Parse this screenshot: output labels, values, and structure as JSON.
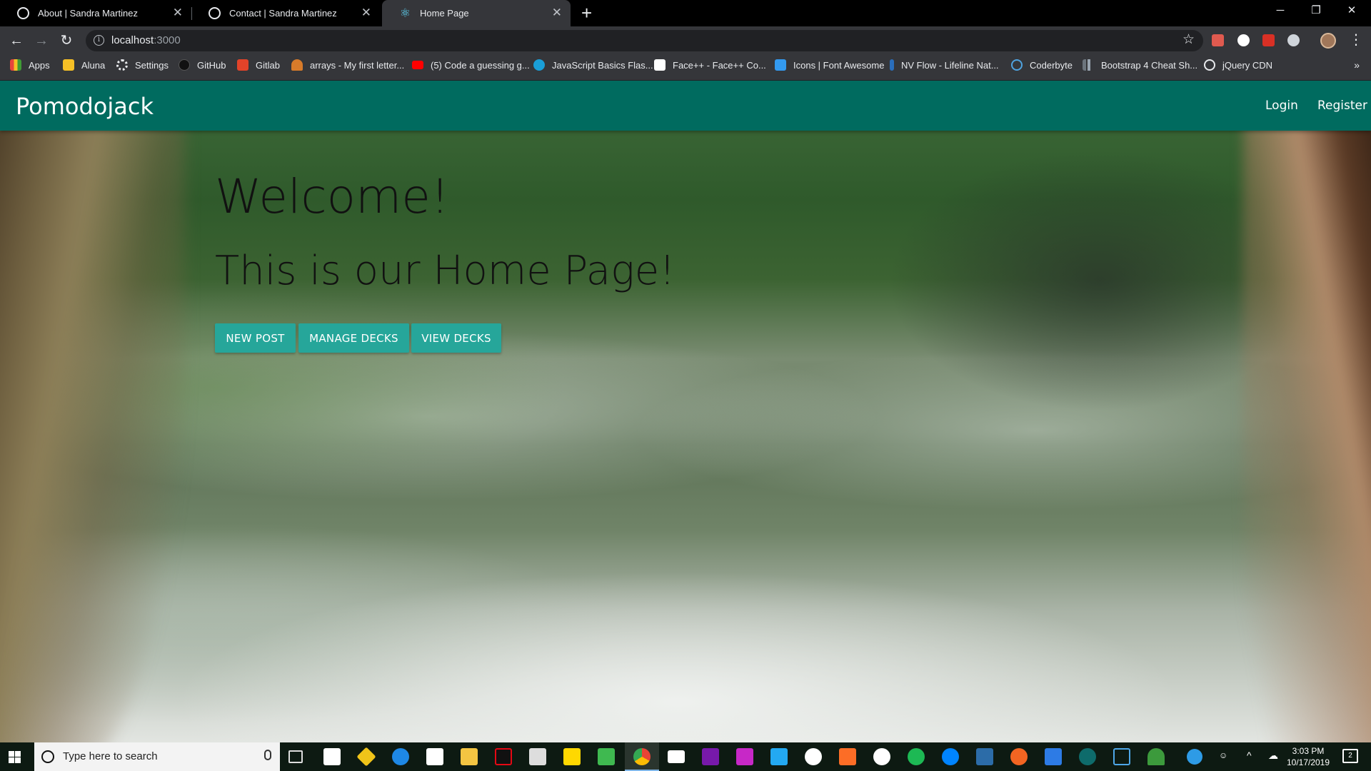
{
  "browser": {
    "tabs": [
      {
        "title": "About | Sandra Martinez",
        "active": false,
        "icon": "github-icon"
      },
      {
        "title": "Contact | Sandra Martinez",
        "active": false,
        "icon": "github-icon"
      },
      {
        "title": "Home Page",
        "active": true,
        "icon": "react-icon"
      }
    ],
    "url_host": "localhost",
    "url_port": ":3000",
    "bookmarks": [
      {
        "label": "Apps",
        "icon": "apps-grid-icon",
        "color": "#e8453c"
      },
      {
        "label": "Aluna",
        "icon": "folder-icon",
        "color": "#f6c026"
      },
      {
        "label": "Settings",
        "icon": "gear-icon",
        "color": "#e8eaed"
      },
      {
        "label": "GitHub",
        "icon": "github-icon",
        "color": "#202124"
      },
      {
        "label": "Gitlab",
        "icon": "gitlab-icon",
        "color": "#e24329"
      },
      {
        "label": "arrays - My first letter...",
        "icon": "person-icon",
        "color": "#d77b2a"
      },
      {
        "label": "(5) Code a guessing g...",
        "icon": "youtube-icon",
        "color": "#ff0000"
      },
      {
        "label": "JavaScript Basics Flas...",
        "icon": "c-icon",
        "color": "#1a9fd8"
      },
      {
        "label": "Face++ - Face++ Co...",
        "icon": "m-icon",
        "color": "#ffffff"
      },
      {
        "label": "Icons | Font Awesome",
        "icon": "flag-icon",
        "color": "#339af0"
      },
      {
        "label": "NV Flow - Lifeline Nat...",
        "icon": "nv-icon",
        "color": "#2a6ebb"
      },
      {
        "label": "Coderbyte",
        "icon": "hexagon-icon",
        "color": "#4fa3e0"
      },
      {
        "label": "Bootstrap 4 Cheat Sh...",
        "icon": "chart-icon",
        "color": "#6c757d"
      },
      {
        "label": "jQuery CDN",
        "icon": "jquery-icon",
        "color": "#e8eaed"
      }
    ],
    "more_label": "»"
  },
  "app": {
    "brand": "Pomodojack",
    "nav": {
      "login": "Login",
      "register": "Register"
    },
    "hero": {
      "title": "Welcome!",
      "subtitle": "This is our Home Page!"
    },
    "buttons": {
      "new_post": "NEW POST",
      "manage_decks": "MANAGE DECKS",
      "view_decks": "VIEW DECKS"
    },
    "colors": {
      "navbar": "#006b5f",
      "button": "#26a69a"
    }
  },
  "taskbar": {
    "search_placeholder": "Type here to search",
    "time": "3:03 PM",
    "date": "10/17/2019",
    "notification_count": "2"
  }
}
